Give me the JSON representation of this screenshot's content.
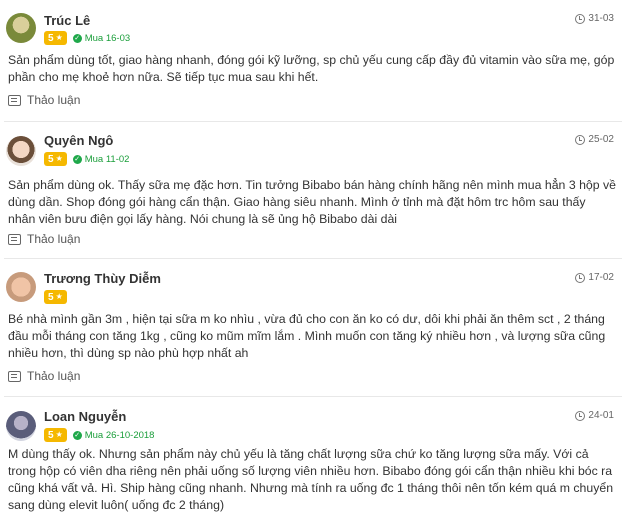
{
  "reviews": [
    {
      "name": "Trúc Lê",
      "rating": "5",
      "purchase": "Mua 16-03",
      "date": "31-03",
      "content": "Sản phẩm dùng tốt, giao hàng nhanh, đóng gói kỹ lưỡng, sp chủ yếu cung cấp đầy đủ vitamin vào sữa mẹ, góp phần cho mẹ khoẻ hơn nữa. Sẽ tiếp tục mua sau khi hết.",
      "discuss": "Thảo luận"
    },
    {
      "name": "Quyên Ngô",
      "rating": "5",
      "purchase": "Mua 11-02",
      "date": "25-02",
      "content": "Sản phẩm dùng ok. Thấy sữa mẹ đặc hơn. Tin tưởng Bibabo bán hàng chính hãng nên mình mua hẳn 3 hộp về dùng dần. Shop đóng gói hàng cẩn thận. Giao hàng siêu nhanh. Mình ở tỉnh mà đặt hôm trc hôm sau thấy nhân viên bưu điện gọi lấy hàng. Nói chung là sẽ ủng hộ Bibabo dài dài",
      "discuss": "Thảo luận"
    },
    {
      "name": "Trương Thùy Diễm",
      "rating": "5",
      "purchase": "",
      "date": "17-02",
      "content": "Bé nhà mình gần 3m , hiện tại sữa m ko nhìu , vừa đủ cho con ăn ko có dư, dôi khi phải ăn thêm sct , 2 tháng đầu mỗi tháng con tăng 1kg , cũng ko mũm mĩm lắm . Mình muốn con tăng ký nhiều hơn , và lượng sữa cũng nhiều hơn, thì dùng sp nào phù hợp nhất ah",
      "discuss": "Thảo luận"
    },
    {
      "name": "Loan Nguyễn",
      "rating": "5",
      "purchase": "Mua 26-10-2018",
      "date": "24-01",
      "content": "M dùng thấy ok. Nhưng sản phẩm này chủ yếu là tăng chất lượng sữa chứ ko tăng lượng sữa mấy. Với cả trong hộp có viên dha riêng nên phải uống số lượng viên nhiều hơn. Bibabo đóng gói cẩn thận nhiều khi bóc ra cũng khá vất vả. Hì. Ship hàng cũng nhanh. Nhưng mà tính ra uống đc 1 tháng thôi nên tốn kém quá m chuyển sang dùng elevit luôn( uống đc 2 tháng)",
      "discuss": ""
    }
  ],
  "icons": {
    "rating": "star-icon",
    "purchase": "check-circle-icon",
    "date": "clock-icon",
    "discuss": "comment-icon"
  },
  "colors": {
    "rating_badge": "#f5b800",
    "purchase_text": "#1a9e3a",
    "divider": "#e8e8e8"
  }
}
